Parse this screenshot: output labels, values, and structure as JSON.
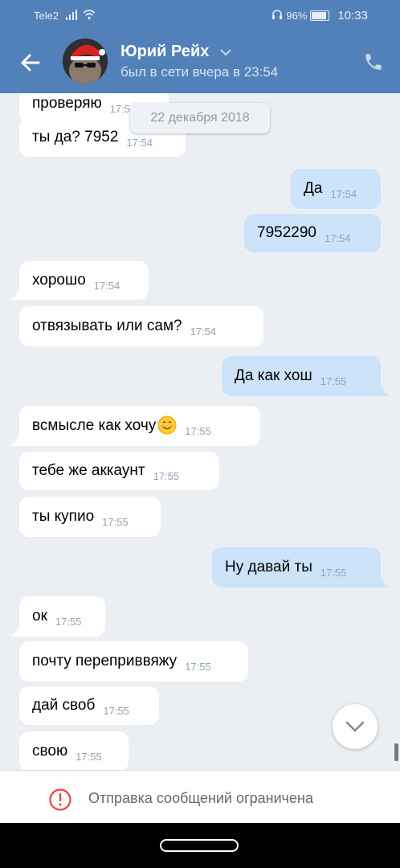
{
  "status_bar": {
    "carrier": "Tele2",
    "battery": "96%",
    "battery_level": 0.96,
    "time": "10:33"
  },
  "header": {
    "name": "Юрий Рейх",
    "last_seen": "был в сети вчера в 23:54"
  },
  "date_badge": "22 декабря 2018",
  "messages": [
    {
      "dir": "in",
      "text": "проверяю",
      "time": "17:54"
    },
    {
      "dir": "in",
      "text": "ты да? 7952",
      "time": "17:54"
    },
    {
      "dir": "out",
      "text": "Да",
      "time": "17:54"
    },
    {
      "dir": "out",
      "text": "7952290",
      "time": "17:54"
    },
    {
      "dir": "in",
      "text": "хорошо",
      "time": "17:54"
    },
    {
      "dir": "in",
      "text": "отвязывать или сам?",
      "time": "17:54"
    },
    {
      "dir": "out",
      "text": "Да как хош",
      "time": "17:55"
    },
    {
      "dir": "in",
      "text": "всмысле как хочу",
      "time": "17:55"
    },
    {
      "dir": "in",
      "text": "тебе же аккаунт",
      "time": "17:55"
    },
    {
      "dir": "in",
      "text": "ты купио",
      "time": "17:55"
    },
    {
      "dir": "out",
      "text": "Ну давай ты",
      "time": "17:55"
    },
    {
      "dir": "in",
      "text": "ок",
      "time": "17:55"
    },
    {
      "dir": "in",
      "text": "почту переприввяжу",
      "time": "17:55"
    },
    {
      "dir": "in",
      "text": "дай своб",
      "time": "17:55"
    },
    {
      "dir": "in",
      "text": "свою",
      "time": "17:55"
    }
  ],
  "input_bar": {
    "restricted_text": "Отправка сообщений ограничена"
  },
  "colors": {
    "header": "#5181b8",
    "background": "#ebeff3",
    "outgoing": "#cce3fa",
    "incoming": "#ffffff",
    "warning": "#e64646"
  }
}
